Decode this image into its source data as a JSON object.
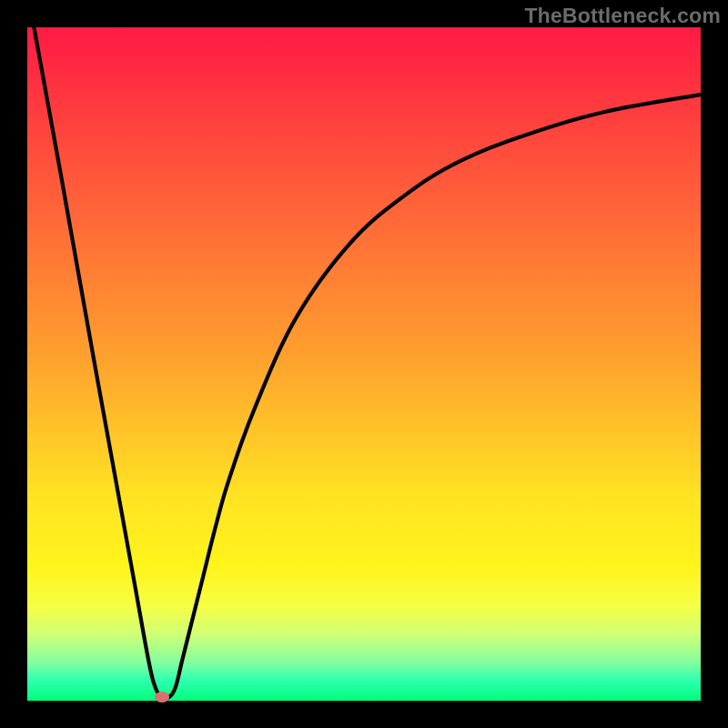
{
  "watermark": "TheBottleneck.com",
  "colors": {
    "frame": "#000000",
    "curve": "#000000",
    "dot": "#d9706f",
    "gradient_top": "#ff1a44",
    "gradient_bottom": "#00ff7b"
  },
  "chart_data": {
    "type": "line",
    "title": "",
    "xlabel": "",
    "ylabel": "",
    "xlim": [
      0,
      100
    ],
    "ylim": [
      0,
      100
    ],
    "grid": false,
    "legend": false,
    "series": [
      {
        "name": "bottleneck_curve",
        "x": [
          1,
          5,
          10,
          14,
          16,
          18,
          19,
          20,
          21,
          22,
          23,
          24,
          26,
          28,
          30,
          34,
          40,
          48,
          56,
          64,
          74,
          86,
          100
        ],
        "y": [
          100,
          78,
          50,
          28,
          17,
          6,
          2,
          0.5,
          0.5,
          2,
          6,
          10,
          18,
          26,
          33,
          44,
          57,
          68,
          75,
          80,
          84,
          87.5,
          90
        ]
      }
    ],
    "annotations": [
      {
        "name": "optimal_point",
        "x": 20,
        "y": 0.5
      }
    ]
  }
}
